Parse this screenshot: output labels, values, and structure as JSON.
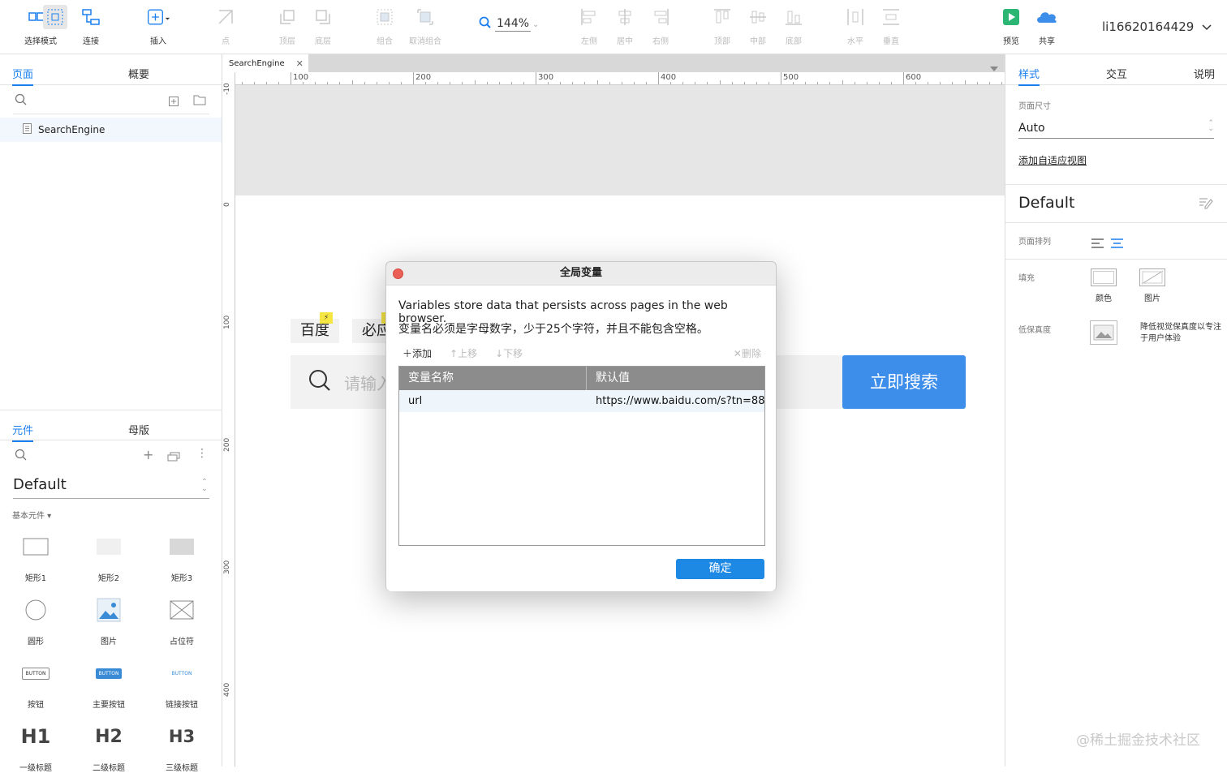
{
  "toolbar": {
    "select_mode": "选择模式",
    "connect": "连接",
    "insert": "插入",
    "point": "点",
    "top_layer": "顶层",
    "bottom_layer": "底层",
    "group": "组合",
    "ungroup": "取消组合",
    "zoom": "144%",
    "align_left": "左侧",
    "align_center": "居中",
    "align_right": "右侧",
    "align_top": "顶部",
    "align_middle": "中部",
    "align_bottom": "底部",
    "distribute_h": "水平",
    "distribute_v": "垂直",
    "preview": "预览",
    "share": "共享",
    "username": "li16620164429"
  },
  "left_panel": {
    "tab_pages": "页面",
    "tab_outline": "概要",
    "page_item": "SearchEngine",
    "tab_widgets": "元件",
    "tab_masters": "母版",
    "library_select": "Default",
    "section_basic": "基本元件 ▾",
    "widgets": [
      {
        "label": "矩形1"
      },
      {
        "label": "矩形2"
      },
      {
        "label": "矩形3"
      },
      {
        "label": "圆形"
      },
      {
        "label": "图片"
      },
      {
        "label": "占位符"
      },
      {
        "label": "按钮",
        "glyph": "BUTTON"
      },
      {
        "label": "主要按钮",
        "glyph": "BUTTON"
      },
      {
        "label": "链接按钮",
        "glyph": "BUTTON"
      },
      {
        "label": "一级标题",
        "glyph": "H1"
      },
      {
        "label": "二级标题",
        "glyph": "H2"
      },
      {
        "label": "三级标题",
        "glyph": "H3"
      }
    ]
  },
  "canvas": {
    "file_tab": "SearchEngine",
    "ruler_h": [
      "100",
      "200",
      "300",
      "400",
      "500",
      "600"
    ],
    "ruler_v": [
      "0",
      "100",
      "200",
      "300",
      "400"
    ],
    "ruler_v_top": "-10",
    "nav_items": [
      "百度",
      "必应"
    ],
    "search_placeholder": "请输入",
    "search_button": "立即搜索"
  },
  "dialog": {
    "title": "全局变量",
    "desc_line1": "Variables store data that persists across pages in the web browser.",
    "desc_line2": "变量名必须是字母数字，少于25个字符，并且不能包含空格。",
    "btn_add": "添加",
    "btn_up": "上移",
    "btn_down": "下移",
    "btn_delete": "删除",
    "col_name": "变量名称",
    "col_default": "默认值",
    "rows": [
      {
        "name": "url",
        "value": "https://www.baidu.com/s?tn=88"
      }
    ],
    "ok": "确定"
  },
  "right_panel": {
    "tab_style": "样式",
    "tab_interact": "交互",
    "tab_notes": "说明",
    "page_size_label": "页面尺寸",
    "page_size_value": "Auto",
    "adaptive_link": "添加自适应视图",
    "style_name": "Default",
    "page_align_label": "页面排列",
    "fill_label": "填充",
    "fill_color": "颜色",
    "fill_image": "图片",
    "low_fidelity_label": "低保真度",
    "low_fidelity_desc": "降低视觉保真度以专注于用户体验"
  },
  "watermark": "@稀土掘金技术社区",
  "colors": {
    "accent": "#1b7ff0",
    "search_button": "#3d8eea",
    "ok_button": "#1e88e5"
  }
}
